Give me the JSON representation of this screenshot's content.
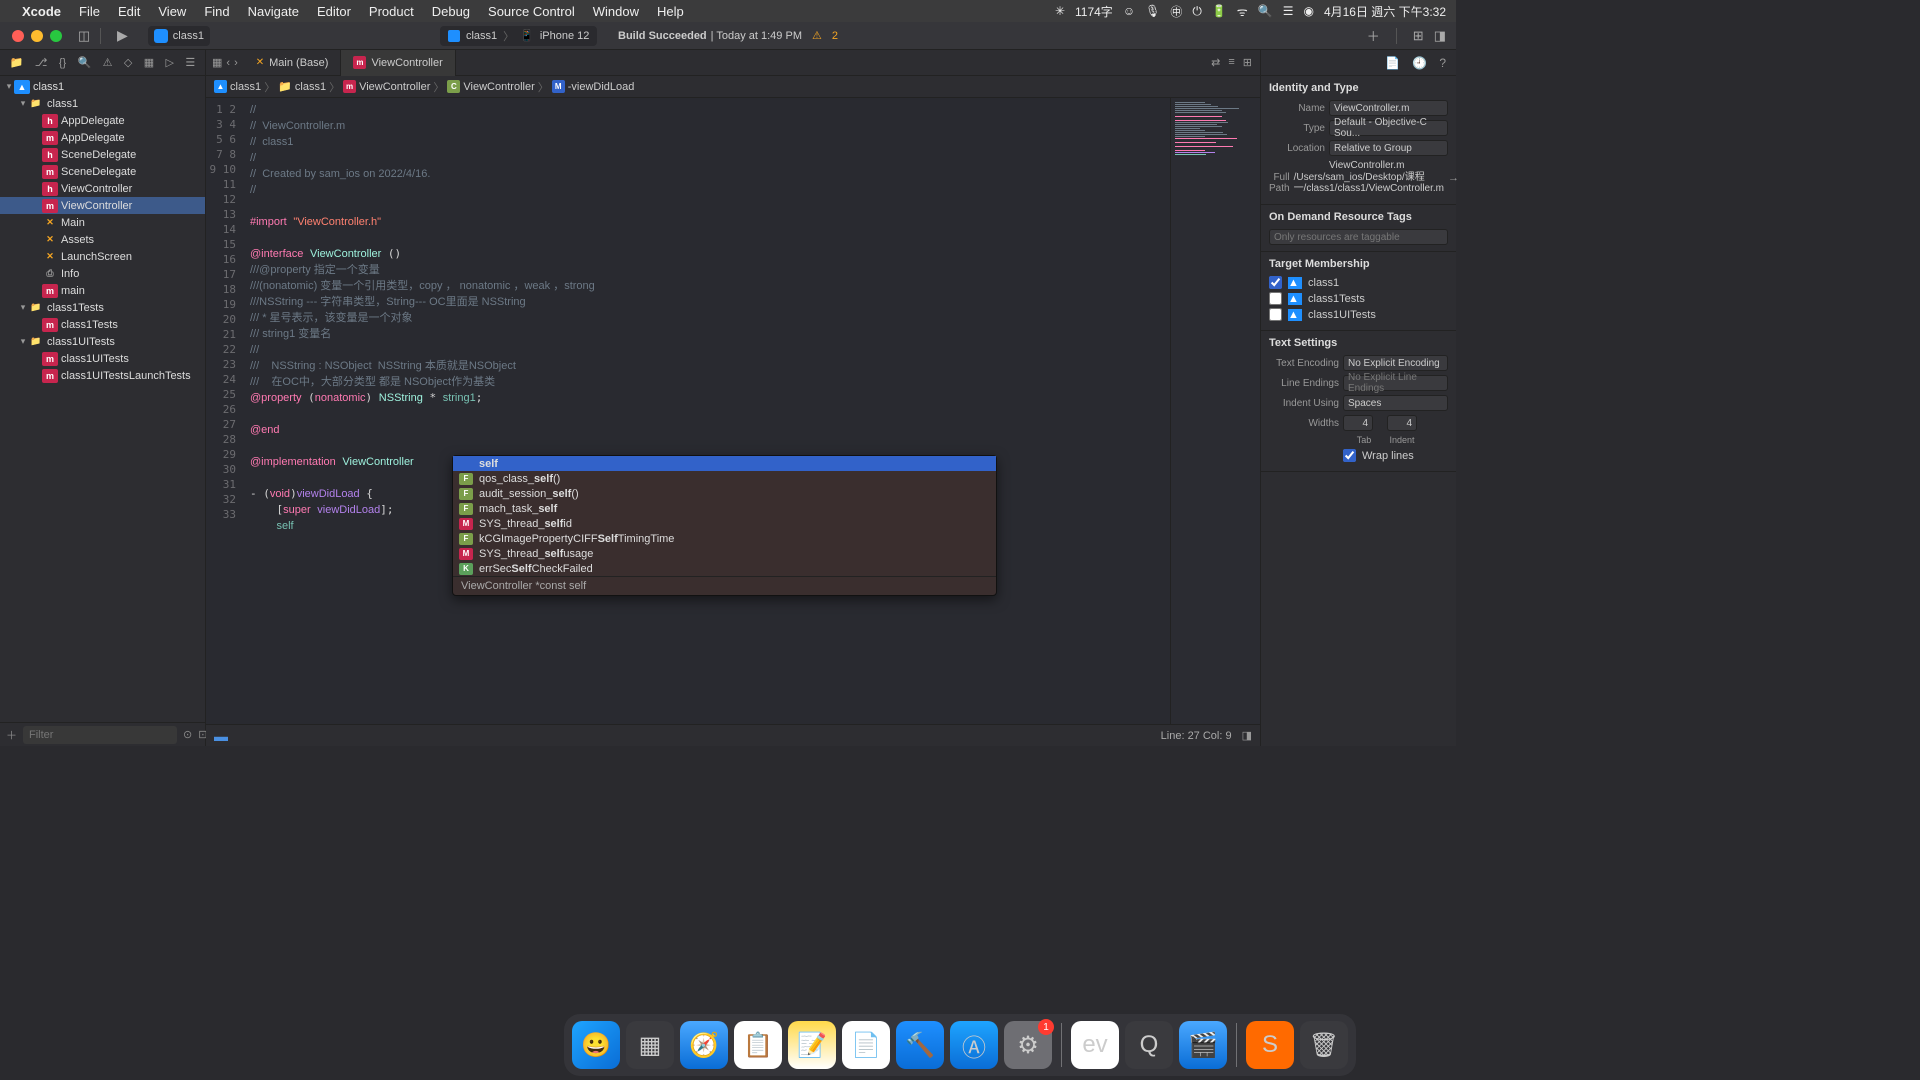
{
  "menubar": {
    "app": "Xcode",
    "items": [
      "File",
      "Edit",
      "View",
      "Find",
      "Navigate",
      "Editor",
      "Product",
      "Debug",
      "Source Control",
      "Window",
      "Help"
    ],
    "right": {
      "chars": "1174字",
      "date": "4月16日 週六 下午3:32"
    }
  },
  "toolbar": {
    "scheme": "class1",
    "run_target_app": "class1",
    "run_target_device": "iPhone 12",
    "status_text": "Build Succeeded",
    "status_time": " | Today at 1:49 PM",
    "warning_count": "2"
  },
  "navigator": {
    "project": "class1",
    "folder1": "class1",
    "files1": [
      {
        "icon": "h",
        "name": "AppDelegate"
      },
      {
        "icon": "m",
        "name": "AppDelegate"
      },
      {
        "icon": "h",
        "name": "SceneDelegate"
      },
      {
        "icon": "m",
        "name": "SceneDelegate"
      },
      {
        "icon": "h",
        "name": "ViewController"
      },
      {
        "icon": "m",
        "name": "ViewController",
        "selected": true
      },
      {
        "icon": "x",
        "name": "Main"
      },
      {
        "icon": "x",
        "name": "Assets"
      },
      {
        "icon": "x",
        "name": "LaunchScreen"
      },
      {
        "icon": "plist",
        "name": "Info"
      },
      {
        "icon": "m",
        "name": "main"
      }
    ],
    "folder2": "class1Tests",
    "files2": [
      {
        "icon": "m",
        "name": "class1Tests"
      }
    ],
    "folder3": "class1UITests",
    "files3": [
      {
        "icon": "m",
        "name": "class1UITests"
      },
      {
        "icon": "m",
        "name": "class1UITestsLaunchTests"
      }
    ],
    "filter_placeholder": "Filter"
  },
  "editor": {
    "tab1": "Main (Base)",
    "tab2": "ViewController",
    "jump": [
      "class1",
      "class1",
      "ViewController",
      "ViewController",
      "-viewDidLoad"
    ],
    "line_start": 1,
    "line_end": 33,
    "cursor": "Line: 27  Col: 9"
  },
  "code_lines": [
    {
      "n": 1,
      "t": "//",
      "cls": "c-comment"
    },
    {
      "n": 2,
      "t": "//  ViewController.m",
      "cls": "c-comment"
    },
    {
      "n": 3,
      "t": "//  class1",
      "cls": "c-comment"
    },
    {
      "n": 4,
      "t": "//",
      "cls": "c-comment"
    },
    {
      "n": 5,
      "t": "//  Created by sam_ios on 2022/4/16.",
      "cls": "c-comment"
    },
    {
      "n": 6,
      "t": "//",
      "cls": "c-comment"
    },
    {
      "n": 7,
      "t": "",
      "cls": ""
    },
    {
      "n": 8,
      "html": "<span class='c-keyword'>#import</span> <span class='c-string'>\"ViewController.h\"</span>"
    },
    {
      "n": 9,
      "t": "",
      "cls": ""
    },
    {
      "n": 10,
      "html": "<span class='c-keyword'>@interface</span> <span class='c-type'>ViewController</span> ()"
    },
    {
      "n": 11,
      "t": "///@property 指定一个变量",
      "cls": "c-comment"
    },
    {
      "n": 12,
      "t": "///(nonatomic) 变量一个引用类型，copy ， nonatomic ，weak ，strong",
      "cls": "c-comment"
    },
    {
      "n": 13,
      "t": "///NSString --- 字符串类型，String--- OC里面是 NSString",
      "cls": "c-comment"
    },
    {
      "n": 14,
      "t": "/// * 星号表示，该变量是一个对象",
      "cls": "c-comment"
    },
    {
      "n": 15,
      "t": "/// string1 变量名",
      "cls": "c-comment"
    },
    {
      "n": 16,
      "t": "///",
      "cls": "c-comment"
    },
    {
      "n": 17,
      "t": "///    NSString : NSObject  NSString 本质就是NSObject",
      "cls": "c-comment"
    },
    {
      "n": 18,
      "t": "///    在OC中，大部分类型 都是 NSObject作为基类",
      "cls": "c-comment"
    },
    {
      "n": 19,
      "html": "<span class='c-keyword'>@property</span> (<span class='c-keyword'>nonatomic</span>) <span class='c-type'>NSString</span> * <span class='c-prop'>string1</span>;"
    },
    {
      "n": 20,
      "t": "",
      "cls": ""
    },
    {
      "n": 21,
      "html": "<span class='c-keyword'>@end</span>"
    },
    {
      "n": 22,
      "t": "",
      "cls": ""
    },
    {
      "n": 23,
      "html": "<span class='c-keyword'>@implementation</span> <span class='c-type'>ViewController</span>"
    },
    {
      "n": 24,
      "t": "",
      "cls": ""
    },
    {
      "n": 25,
      "html": "- (<span class='c-keyword'>void</span>)<span class='c-func'>viewDidLoad</span> {"
    },
    {
      "n": 26,
      "html": "    [<span class='c-keyword'>super</span> <span class='c-func'>viewDidLoad</span>];"
    },
    {
      "n": 27,
      "html": "    <span class='c-ident'>self</span>"
    },
    {
      "n": 28,
      "t": "",
      "cls": ""
    },
    {
      "n": 29,
      "t": "",
      "cls": ""
    },
    {
      "n": 30,
      "t": "",
      "cls": ""
    },
    {
      "n": 31,
      "t": "",
      "cls": ""
    },
    {
      "n": 32,
      "t": "",
      "cls": ""
    },
    {
      "n": 33,
      "t": "",
      "cls": ""
    }
  ],
  "autocomplete": {
    "items": [
      {
        "icon": "blank",
        "text": "self",
        "sel": true
      },
      {
        "icon": "f",
        "pre": "qos_class_",
        "hl": "self",
        "post": "()"
      },
      {
        "icon": "f",
        "pre": "audit_session_",
        "hl": "self",
        "post": "()"
      },
      {
        "icon": "f",
        "pre": "mach_task_",
        "hl": "self",
        "post": ""
      },
      {
        "icon": "m",
        "pre": "SYS_thread_",
        "hl": "self",
        "post": "id"
      },
      {
        "icon": "f",
        "pre": "kCGImagePropertyCIFF",
        "hl": "Self",
        "post": "TimingTime"
      },
      {
        "icon": "m",
        "pre": "SYS_thread_",
        "hl": "self",
        "post": "usage"
      },
      {
        "icon": "k",
        "pre": "errSec",
        "hl": "Self",
        "post": "CheckFailed"
      }
    ],
    "hint": "ViewController *const self"
  },
  "inspector": {
    "identity_title": "Identity and Type",
    "name_label": "Name",
    "name_val": "ViewController.m",
    "type_label": "Type",
    "type_val": "Default - Objective-C Sou...",
    "loc_label": "Location",
    "loc_val": "Relative to Group",
    "loc_file": "ViewController.m",
    "fullpath_label": "Full Path",
    "fullpath_val": "/Users/sam_ios/Desktop/课程一/class1/class1/ViewController.m",
    "ondemand_title": "On Demand Resource Tags",
    "ondemand_placeholder": "Only resources are taggable",
    "target_title": "Target Membership",
    "targets": [
      {
        "name": "class1",
        "checked": true
      },
      {
        "name": "class1Tests",
        "checked": false
      },
      {
        "name": "class1UITests",
        "checked": false
      }
    ],
    "text_title": "Text Settings",
    "enc_label": "Text Encoding",
    "enc_val": "No Explicit Encoding",
    "le_label": "Line Endings",
    "le_val": "No Explicit Line Endings",
    "indent_label": "Indent Using",
    "indent_val": "Spaces",
    "widths_label": "Widths",
    "tab_val": "4",
    "tab_lbl": "Tab",
    "indent_val2": "4",
    "indent_lbl": "Indent",
    "wrap_label": "Wrap lines"
  },
  "dock_badge": "1"
}
